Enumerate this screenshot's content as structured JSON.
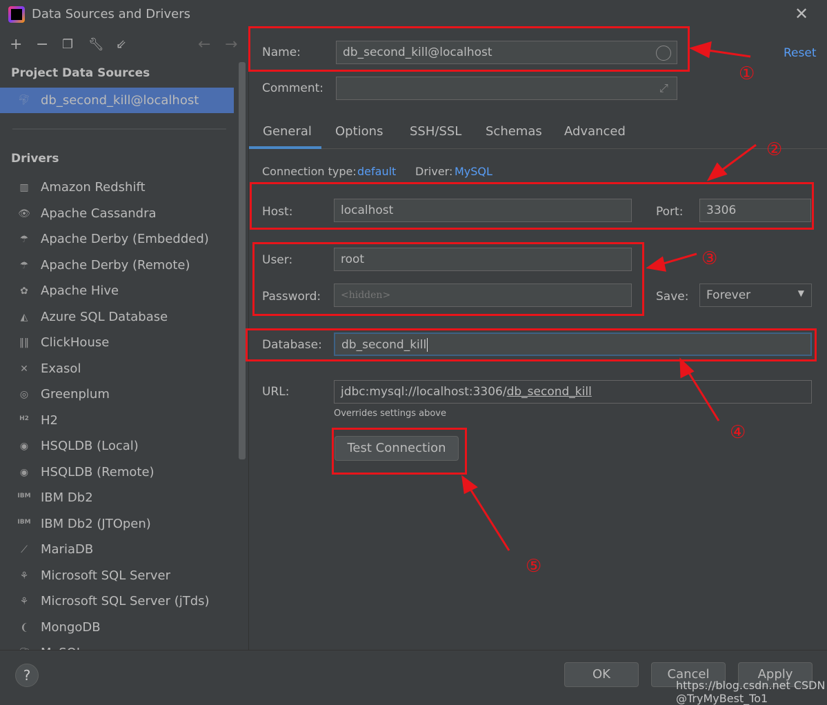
{
  "window": {
    "title": "Data Sources and Drivers"
  },
  "sidebar": {
    "project_header": "Project Data Sources",
    "project_items": [
      {
        "label": "db_second_kill@localhost",
        "icon": "mysql-dolphin-icon"
      }
    ],
    "drivers_header": "Drivers",
    "drivers": [
      {
        "label": "Amazon Redshift",
        "icon": "redshift-icon"
      },
      {
        "label": "Apache Cassandra",
        "icon": "cassandra-icon"
      },
      {
        "label": "Apache Derby (Embedded)",
        "icon": "derby-icon"
      },
      {
        "label": "Apache Derby (Remote)",
        "icon": "derby-icon"
      },
      {
        "label": "Apache Hive",
        "icon": "hive-icon"
      },
      {
        "label": "Azure SQL Database",
        "icon": "azure-icon"
      },
      {
        "label": "ClickHouse",
        "icon": "clickhouse-icon"
      },
      {
        "label": "Exasol",
        "icon": "exasol-icon"
      },
      {
        "label": "Greenplum",
        "icon": "greenplum-icon"
      },
      {
        "label": "H2",
        "icon": "h2-icon"
      },
      {
        "label": "HSQLDB (Local)",
        "icon": "hsqldb-icon"
      },
      {
        "label": "HSQLDB (Remote)",
        "icon": "hsqldb-icon"
      },
      {
        "label": "IBM Db2",
        "icon": "db2-icon"
      },
      {
        "label": "IBM Db2 (JTOpen)",
        "icon": "db2-icon"
      },
      {
        "label": "MariaDB",
        "icon": "mariadb-icon"
      },
      {
        "label": "Microsoft SQL Server",
        "icon": "mssql-icon"
      },
      {
        "label": "Microsoft SQL Server (jTds)",
        "icon": "mssql-icon"
      },
      {
        "label": "MongoDB",
        "icon": "mongodb-icon"
      },
      {
        "label": "MySQL",
        "icon": "mysql-icon"
      }
    ]
  },
  "form": {
    "name_label": "Name:",
    "name_value": "db_second_kill@localhost",
    "reset": "Reset",
    "comment_label": "Comment:",
    "comment_value": "",
    "tabs": [
      "General",
      "Options",
      "SSH/SSL",
      "Schemas",
      "Advanced"
    ],
    "active_tab": "General",
    "conn_type_label": "Connection type:",
    "conn_type_value": "default",
    "driver_label": "Driver:",
    "driver_value": "MySQL",
    "host_label": "Host:",
    "host_value": "localhost",
    "port_label": "Port:",
    "port_value": "3306",
    "user_label": "User:",
    "user_value": "root",
    "password_label": "Password:",
    "password_placeholder": "<hidden>",
    "save_label": "Save:",
    "save_value": "Forever",
    "database_label": "Database:",
    "database_value": "db_second_kill",
    "url_label": "URL:",
    "url_prefix": "jdbc:mysql://localhost:3306/",
    "url_db": "db_second_kill",
    "url_hint": "Overrides settings above",
    "test_connection": "Test Connection"
  },
  "annotations": [
    "①",
    "②",
    "③",
    "④",
    "⑤"
  ],
  "footer": {
    "ok": "OK",
    "cancel": "Cancel",
    "apply": "Apply",
    "help": "?"
  },
  "watermark": "https://blog.csdn.net  CSDN @TryMyBest_To1",
  "colors": {
    "background": "#3c3f41",
    "selection": "#4b6eaf",
    "link": "#589df6",
    "annotation": "#e8141a",
    "field": "#45494a"
  }
}
